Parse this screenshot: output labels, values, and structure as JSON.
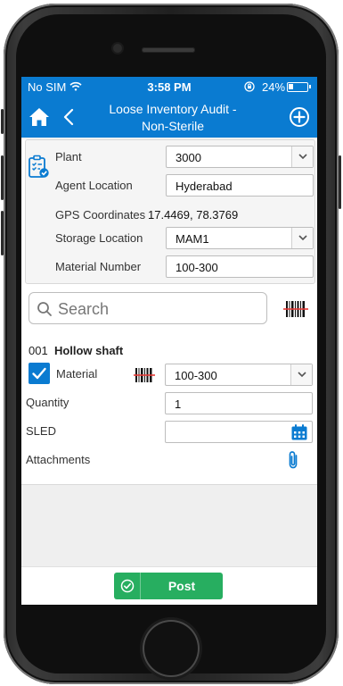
{
  "status_bar": {
    "carrier": "No SIM",
    "time": "3:58 PM",
    "battery_percent": "24%",
    "battery_level": 0.24
  },
  "nav": {
    "title_line1": "Loose Inventory Audit -",
    "title_line2": "Non-Sterile"
  },
  "header": {
    "plant_label": "Plant",
    "plant_value": "3000",
    "agent_location_label": "Agent Location",
    "agent_location_value": "Hyderabad",
    "gps_label": "GPS Coordinates",
    "gps_value": "17.4469, 78.3769",
    "storage_location_label": "Storage Location",
    "storage_location_value": "MAM1",
    "material_number_label": "Material Number",
    "material_number_value": "100-300"
  },
  "search": {
    "placeholder": "Search"
  },
  "item": {
    "number": "001",
    "name": "Hollow shaft",
    "material_label": "Material",
    "material_checked": true,
    "material_value": "100-300",
    "quantity_label": "Quantity",
    "quantity_value": "1",
    "sled_label": "SLED",
    "sled_value": "",
    "attachments_label": "Attachments"
  },
  "footer": {
    "post_label": "Post"
  },
  "colors": {
    "primary": "#0a7bd1",
    "post_green": "#27ae60",
    "barcode_red": "#e53935"
  },
  "icons": [
    "wifi-icon",
    "lock-rotation-icon",
    "battery-icon",
    "home-icon",
    "back-chevron-icon",
    "add-circle-icon",
    "document-check-icon",
    "search-icon",
    "barcode-scan-icon",
    "checkbox-checked-icon",
    "calendar-icon",
    "paperclip-icon",
    "check-circle-icon"
  ]
}
